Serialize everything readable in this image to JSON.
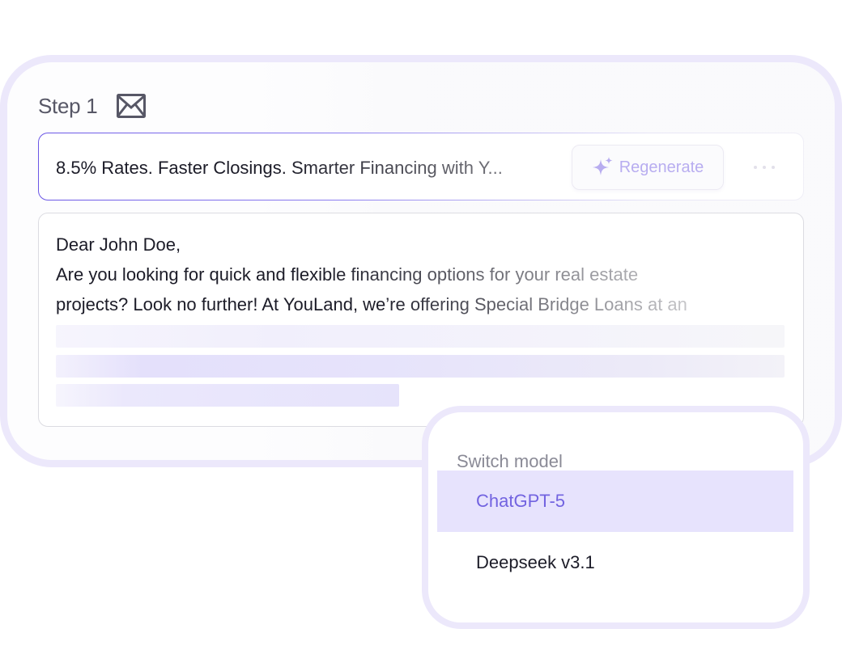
{
  "step": {
    "label": "Step 1",
    "icon": "envelope-icon"
  },
  "subject": {
    "text": "8.5% Rates. Faster Closings. Smarter Financing with Y...",
    "regenerate_label": "Regenerate",
    "regenerate_icon": "sparkle-icon",
    "more_icon": "ellipsis-icon"
  },
  "email_body": {
    "greeting": "Dear John Doe,",
    "lines": [
      "Are you looking for quick and flexible financing options for your real estate",
      "projects? Look no further! At YouLand, we’re offering Special Bridge Loans at an"
    ]
  },
  "model_switcher": {
    "title": "Switch model",
    "options": [
      {
        "label": "ChatGPT-5",
        "selected": true
      },
      {
        "label": "Deepseek v3.1",
        "selected": false
      }
    ]
  },
  "colors": {
    "accent": "#7263e0",
    "card_border": "#ece8fb",
    "selected_bg": "#e7e3fd",
    "regenerate_text": "#b8adf0"
  }
}
